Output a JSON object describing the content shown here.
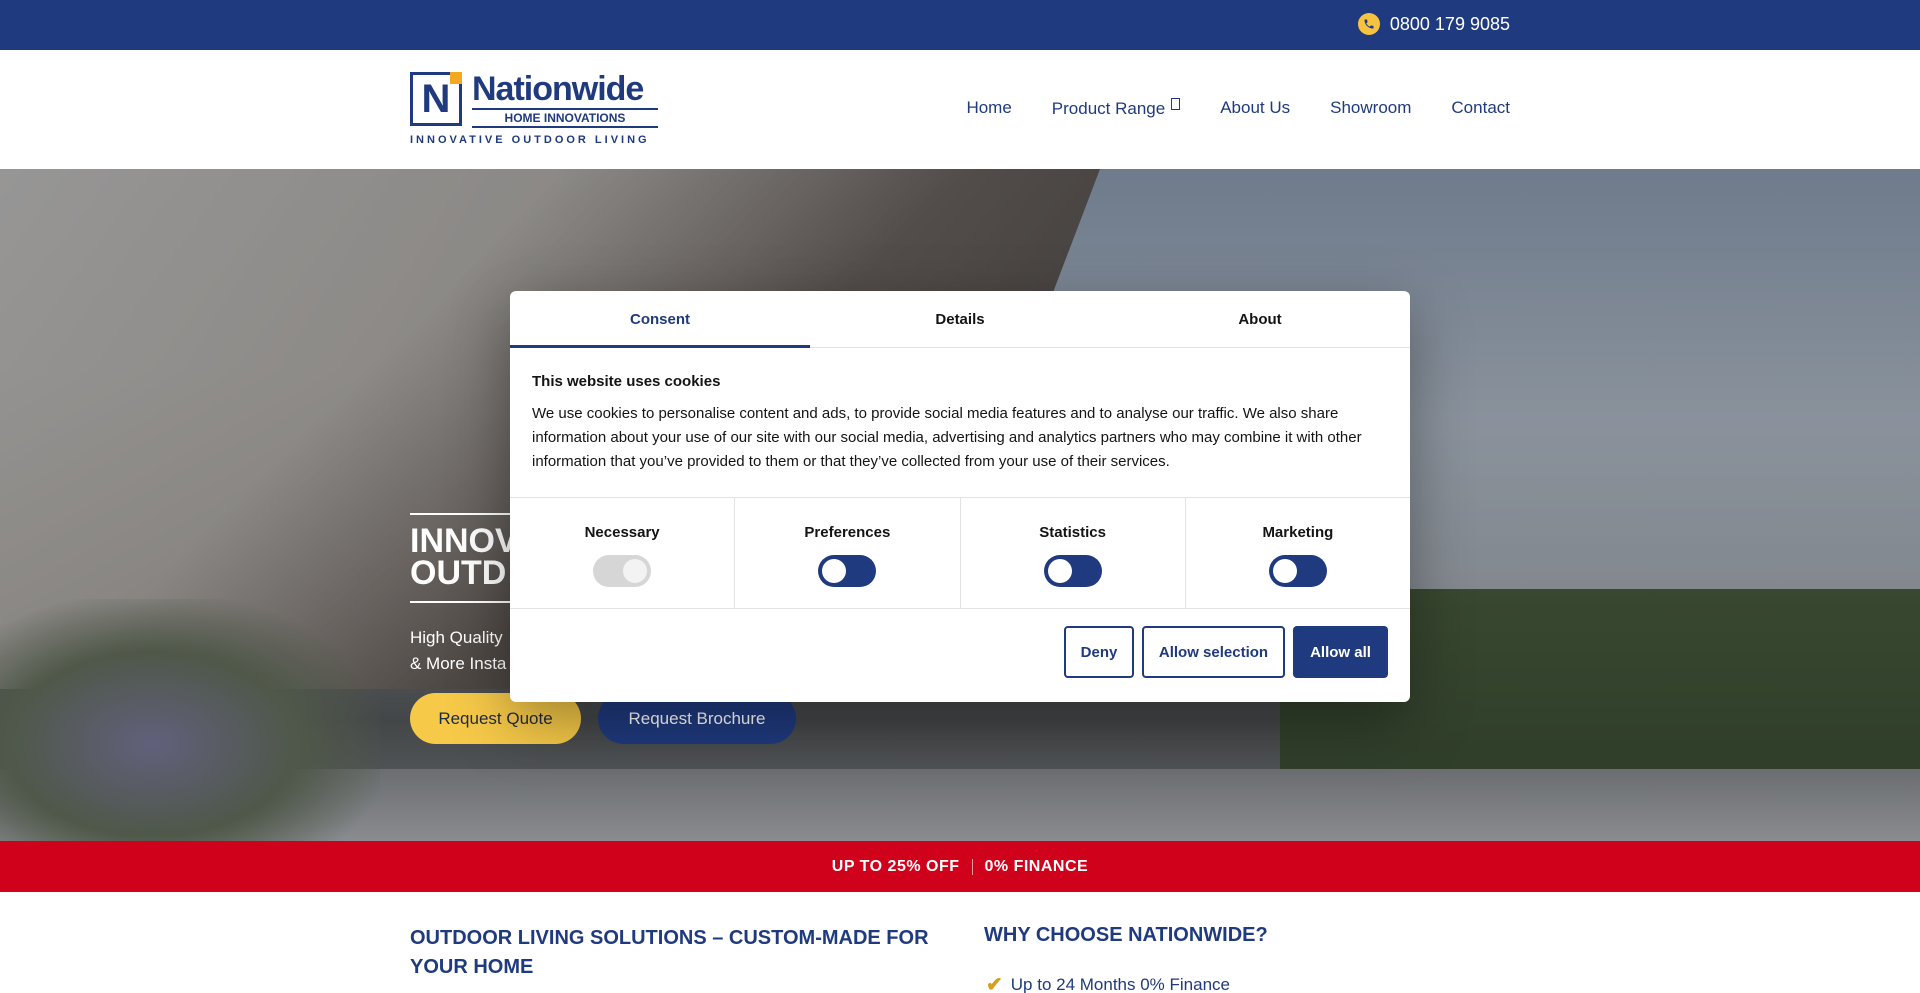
{
  "topbar": {
    "phone": "0800 179 9085",
    "phone_icon": "phone-icon"
  },
  "logo": {
    "mark": "N",
    "name": "Nationwide",
    "sub": "HOME INNOVATIONS",
    "tagline": "INNOVATIVE OUTDOOR LIVING"
  },
  "nav": {
    "items": [
      "Home",
      "Product Range",
      "About Us",
      "Showroom",
      "Contact"
    ]
  },
  "hero": {
    "title_line1": "INNOV",
    "title_line2": "OUTD",
    "subtext_line1": "High Quality",
    "subtext_line2": "& More Insta",
    "quote_button": "Request Quote",
    "brochure_button": "Request Brochure"
  },
  "promo": {
    "left": "UP TO 25% OFF",
    "right": "0% FINANCE"
  },
  "sections": {
    "left_heading": "OUTDOOR LIVING SOLUTIONS – CUSTOM-MADE FOR YOUR HOME",
    "right_heading": "WHY CHOOSE NATIONWIDE?",
    "benefit_1": "Up to 24 Months 0% Finance"
  },
  "cookie_dialog": {
    "tabs": [
      "Consent",
      "Details",
      "About"
    ],
    "active_tab": "Consent",
    "title": "This website uses cookies",
    "body": "We use cookies to personalise content and ads, to provide social media features and to analyse our traffic. We also share information about your use of our site with our social media, advertising and analytics partners who may combine it with other information that you’ve provided to them or that they’ve collected from your use of their services.",
    "toggles": [
      {
        "label": "Necessary",
        "state": "on-disabled"
      },
      {
        "label": "Preferences",
        "state": "off"
      },
      {
        "label": "Statistics",
        "state": "off"
      },
      {
        "label": "Marketing",
        "state": "off"
      }
    ],
    "deny_button": "Deny",
    "allow_selection_button": "Allow selection",
    "allow_all_button": "Allow all"
  },
  "colors": {
    "brand_blue": "#1f3a7e",
    "accent_yellow": "#f6c948",
    "promo_red": "#d0021b"
  }
}
